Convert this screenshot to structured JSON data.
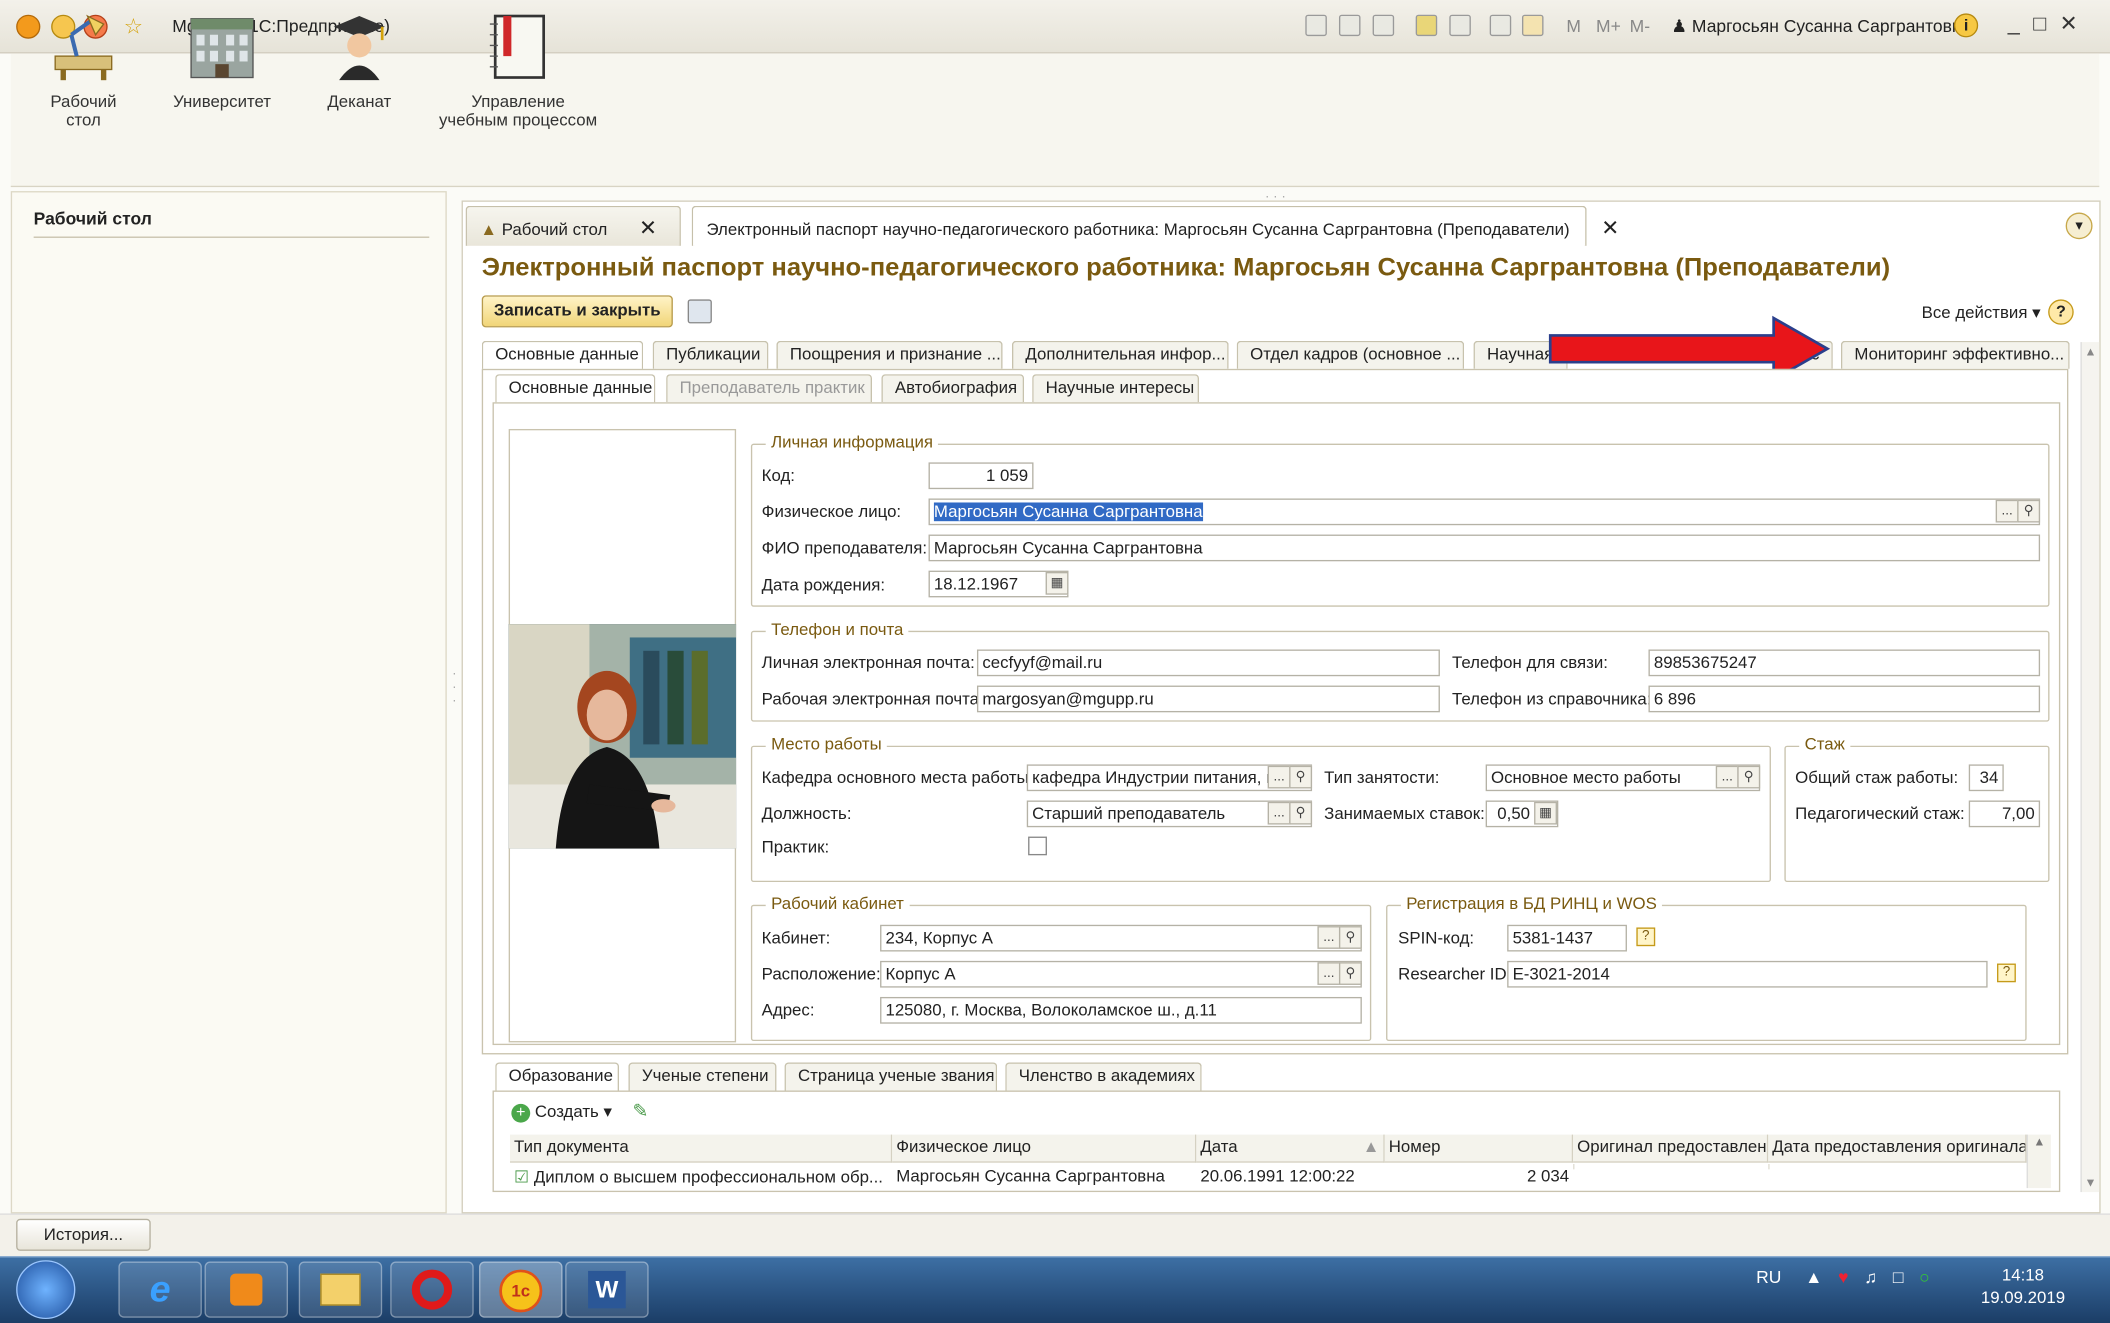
{
  "window": {
    "title": "MguppC  (1С:Предприятие)",
    "user": "Маргосьян Сусанна Саргрантовна",
    "m_buttons": [
      "M",
      "M+",
      "M-"
    ]
  },
  "sections": [
    {
      "label": "Рабочий\nстол",
      "icon": "desk-lamp-icon"
    },
    {
      "label": "Университет",
      "icon": "university-building-icon"
    },
    {
      "label": "Деканат",
      "icon": "graduate-icon"
    },
    {
      "label": "Управление\nучебным процессом",
      "icon": "notebook-icon"
    }
  ],
  "left_panel": {
    "title": "Рабочий стол"
  },
  "work_tabs": [
    {
      "label": "Рабочий стол"
    },
    {
      "label": "Электронный паспорт научно-педагогического работника: Маргосьян Сусанна Саргрантовна (Преподаватели)"
    }
  ],
  "form": {
    "title": "Электронный паспорт научно-педагогического работника: Маргосьян Сусанна Саргрантовна (Преподаватели)",
    "save_close": "Записать и закрыть",
    "all_actions": "Все действия ▾",
    "help": "?"
  },
  "main_tabs": [
    "Основные данные",
    "Публикации",
    "Поощрения и признание ...",
    "Дополнительная инфор...",
    "Отдел кадров (основное ...",
    "Научная",
    "сс",
    "Мониторинг эффективно..."
  ],
  "sub_tabs": [
    "Основные данные",
    "Преподаватель практик",
    "Автобиография",
    "Научные интересы"
  ],
  "personal": {
    "caption": "Личная информация",
    "code_label": "Код:",
    "code": "1 059",
    "person_label": "Физическое лицо:",
    "person": "Маргосьян Сусанна Саргрантовна",
    "fio_label": "ФИО преподавателя:",
    "fio": "Маргосьян Сусанна Саргрантовна",
    "birth_label": "Дата рождения:",
    "birth": "18.12.1967"
  },
  "contacts": {
    "caption": "Телефон и почта",
    "email_personal_label": "Личная электронная почта:",
    "email_personal": "cecfyyf@mail.ru",
    "email_work_label": "Рабочая электронная почта:",
    "email_work": "margosyan@mgupp.ru",
    "phone_label": "Телефон для связи:",
    "phone": "89853675247",
    "phone_dir_label": "Телефон из справочника:",
    "phone_dir": "6 896"
  },
  "workplace": {
    "caption": "Место работы",
    "dept_label": "Кафедра основного места работы:",
    "dept": "кафедра Индустрии питания, гс",
    "position_label": "Должность:",
    "position": "Старший преподаватель",
    "practic_label": "Практик:",
    "emp_type_label": "Тип занятости:",
    "emp_type": "Основное место работы",
    "rate_label": "Занимаемых ставок:",
    "rate": "0,50"
  },
  "experience": {
    "caption": "Стаж",
    "total_label": "Общий стаж работы:",
    "total": "34",
    "ped_label": "Педагогический стаж:",
    "ped": "7,00"
  },
  "office": {
    "caption": "Рабочий кабинет",
    "room_label": "Кабинет:",
    "room": "234, Корпус А",
    "location_label": "Расположение:",
    "location": "Корпус А",
    "address_label": "Адрес:",
    "address": "125080, г. Москва, Волоколамское ш., д.11"
  },
  "registration": {
    "caption": "Регистрация в БД РИНЦ и WOS",
    "spin_label": "SPIN-код:",
    "spin": "5381-1437",
    "rid_label": "Researcher ID:",
    "rid": "E-3021-2014"
  },
  "bottom_tabs": [
    "Образование",
    "Ученые степени",
    "Страница ученые звания",
    "Членство в академиях"
  ],
  "table": {
    "create": "Создать",
    "columns": [
      "Тип документа",
      "Физическое лицо",
      "Дата",
      "Номер",
      "Оригинал предоставлен",
      "Дата предоставления оригинала"
    ],
    "rows": [
      [
        "Диплом о высшем профессиональном обр...",
        "Маргосьян Сусанна Саргрантовна",
        "20.06.1991 12:00:22",
        "2 034",
        "",
        ""
      ]
    ]
  },
  "history_button": "История...",
  "taskbar": {
    "lang": "RU",
    "time": "14:18",
    "date": "19.09.2019"
  },
  "colors": {
    "accent": "#7a5a10",
    "selection": "#316ac5",
    "arrow": "#e8151a"
  }
}
